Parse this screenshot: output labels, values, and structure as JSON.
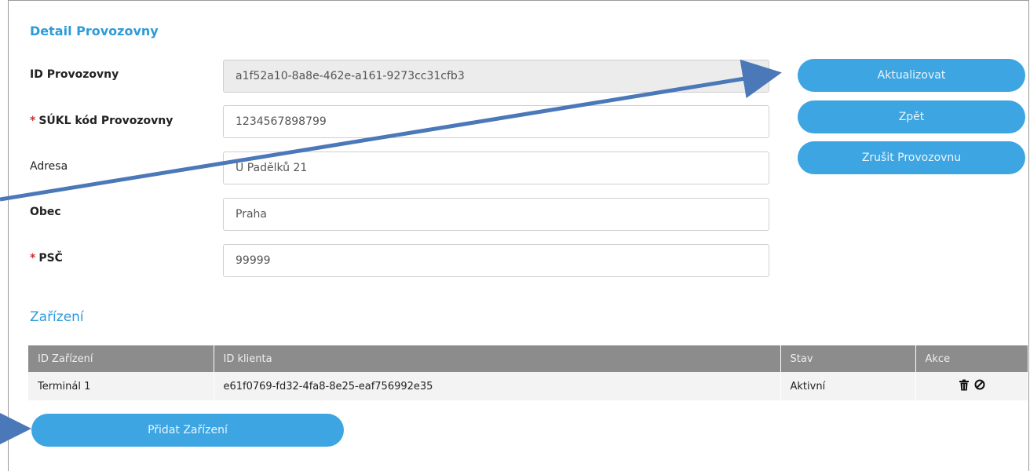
{
  "detail": {
    "title": "Detail Provozovny",
    "fields": [
      {
        "label": "ID Provozovny",
        "required": false,
        "value": "a1f52a10-8a8e-462e-a161-9273cc31cfb3",
        "readonly": true
      },
      {
        "label": "SÚKL kód Provozovny",
        "required": true,
        "value": "1234567898799",
        "readonly": false
      },
      {
        "label": "Adresa",
        "required": false,
        "value": "U Padělků 21",
        "readonly": false
      },
      {
        "label": "Obec",
        "required": false,
        "value": "Praha",
        "readonly": false
      },
      {
        "label": "PSČ",
        "required": true,
        "value": "99999",
        "readonly": false
      }
    ],
    "required_marker": "*"
  },
  "actions": {
    "update": "Aktualizovat",
    "back": "Zpět",
    "cancel_facility": "Zrušit Provozovnu"
  },
  "devices": {
    "title": "Zařízení",
    "columns": [
      "ID Zařízení",
      "ID klienta",
      "Stav",
      "Akce"
    ],
    "rows": [
      {
        "id": "Terminál 1",
        "client_id": "e61f0769-fd32-4fa8-8e25-eaf756992e35",
        "state": "Aktivní"
      }
    ],
    "add_label": "Přidat Zařízení",
    "row_action_icons": [
      "trash-icon",
      "block-icon"
    ]
  },
  "colors": {
    "accent": "#2e9ad8",
    "button": "#3da5e2",
    "required": "#d0312d",
    "table_header": "#8c8c8c",
    "annotation_arrow": "#4a78b8"
  }
}
